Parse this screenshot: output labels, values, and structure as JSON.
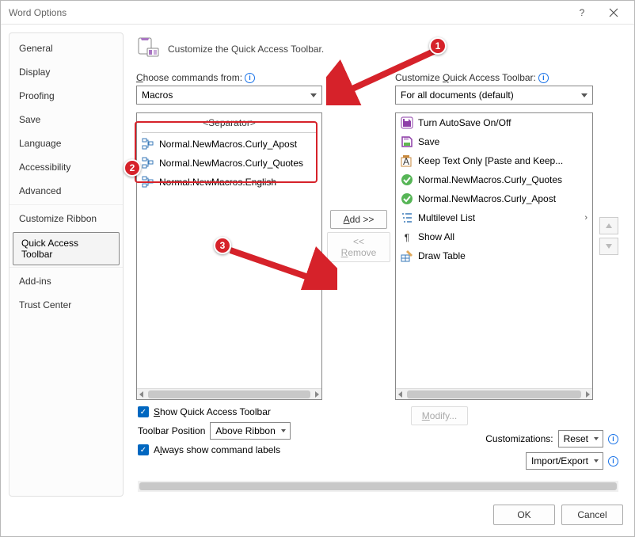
{
  "window": {
    "title": "Word Options"
  },
  "sidebar": {
    "items": [
      {
        "label": "General"
      },
      {
        "label": "Display"
      },
      {
        "label": "Proofing"
      },
      {
        "label": "Save"
      },
      {
        "label": "Language"
      },
      {
        "label": "Accessibility"
      },
      {
        "label": "Advanced"
      },
      {
        "label": "Customize Ribbon"
      },
      {
        "label": "Quick Access Toolbar"
      },
      {
        "label": "Add-ins"
      },
      {
        "label": "Trust Center"
      }
    ]
  },
  "header": {
    "text": "Customize the Quick Access Toolbar."
  },
  "left": {
    "label_pre": "Choose commands from:",
    "combo": "Macros",
    "separator": "<Separator>",
    "items": [
      {
        "label": "Normal.NewMacros.Curly_Apost"
      },
      {
        "label": "Normal.NewMacros.Curly_Quotes"
      },
      {
        "label": "Normal.NewMacros.English"
      }
    ]
  },
  "mid": {
    "add": "Add >>",
    "remove": "<< Remove"
  },
  "right": {
    "label_pre": "Customize Quick Access Toolbar:",
    "combo": "For all documents (default)",
    "items": [
      {
        "icon": "autosave",
        "label": "Turn AutoSave On/Off"
      },
      {
        "icon": "save",
        "label": "Save"
      },
      {
        "icon": "keeptext",
        "label": "Keep Text Only [Paste and Keep..."
      },
      {
        "icon": "check",
        "label": "Normal.NewMacros.Curly_Quotes"
      },
      {
        "icon": "check",
        "label": "Normal.NewMacros.Curly_Apost"
      },
      {
        "icon": "multilist",
        "label": "Multilevel List",
        "submenu": true
      },
      {
        "icon": "pilcrow",
        "label": "Show All"
      },
      {
        "icon": "drawtable",
        "label": "Draw Table"
      }
    ]
  },
  "bottom_left": {
    "show_qat": "Show Quick Access Toolbar",
    "toolbar_pos_label": "Toolbar Position",
    "toolbar_pos_value": "Above Ribbon",
    "always_labels": "Always show command labels"
  },
  "bottom_right": {
    "modify": "Modify...",
    "cust_label": "Customizations:",
    "reset": "Reset",
    "import_export": "Import/Export"
  },
  "footer": {
    "ok": "OK",
    "cancel": "Cancel"
  },
  "annotations": {
    "one": "1",
    "two": "2",
    "three": "3"
  }
}
